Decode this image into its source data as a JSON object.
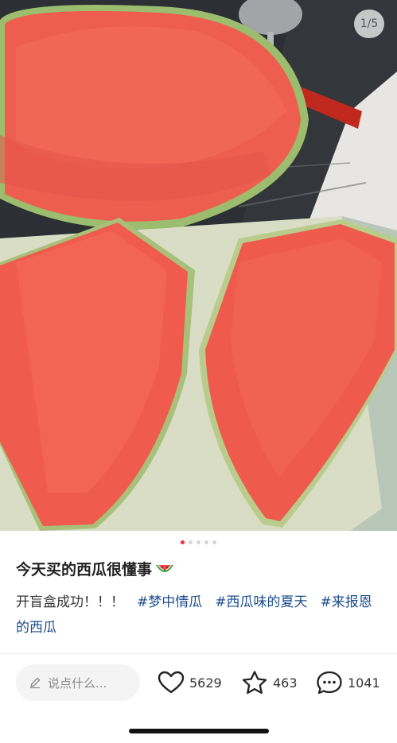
{
  "photo": {
    "counter": "1/5",
    "alt": "watermelon photo"
  },
  "pager": {
    "count": 5,
    "active_index": 0
  },
  "post": {
    "title": "今天买的西瓜很懂事",
    "body": "开盲盒成功！！！",
    "tags": [
      "#梦中情瓜",
      "#西瓜味的夏天",
      "#来报恩的西瓜"
    ]
  },
  "actions": {
    "comment_placeholder": "说点什么...",
    "likes": "5629",
    "favorites": "463",
    "comments": "1041"
  },
  "colors": {
    "accent": "#ff2442",
    "tag": "#1c4e8c"
  },
  "icons": {
    "comment_input": "pencil-icon",
    "like": "heart-icon",
    "favorite": "star-icon",
    "comment": "speech-bubble-icon",
    "emoji": "watermelon-emoji-icon"
  }
}
